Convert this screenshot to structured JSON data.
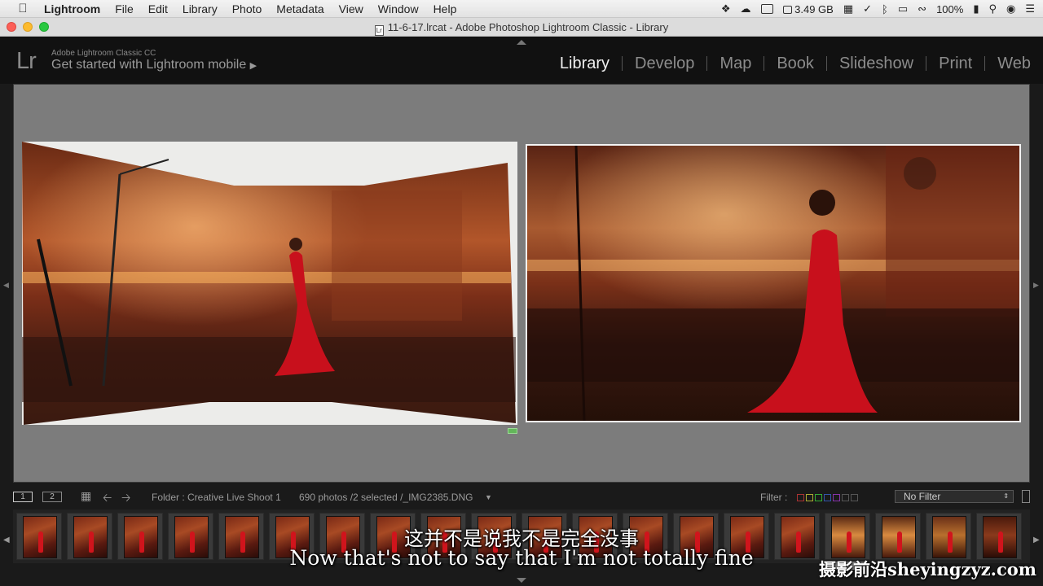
{
  "menubar": {
    "app": "Lightroom",
    "items": [
      "File",
      "Edit",
      "Library",
      "Photo",
      "Metadata",
      "View",
      "Window",
      "Help"
    ],
    "memory": "3.49 GB",
    "battery": "100%"
  },
  "titlebar": {
    "title": "11-6-17.lrcat - Adobe Photoshop Lightroom Classic - Library",
    "doc_icon": "Lr"
  },
  "header": {
    "logo": "Lr",
    "idplate_small": "Adobe Lightroom Classic CC",
    "idplate_big": "Get started with Lightroom mobile",
    "modules": [
      "Library",
      "Develop",
      "Map",
      "Book",
      "Slideshow",
      "Print",
      "Web"
    ],
    "active_module": "Library"
  },
  "toolbar": {
    "view1": "1",
    "view2": "2",
    "folder": "Folder : Creative Live Shoot 1",
    "count": "690 photos /2 selected /_IMG2385.DNG",
    "filter_label": "Filter :",
    "filter_value": "No Filter"
  },
  "subtitles": {
    "zh": "这并不是说我不是完全没事",
    "en": "Now that's not to say that I'm not totally fine"
  },
  "watermark": "摄影前沿sheyingzyz.com",
  "colors": {
    "accent_selected": "#63b65a",
    "dress": "#c8101c"
  }
}
